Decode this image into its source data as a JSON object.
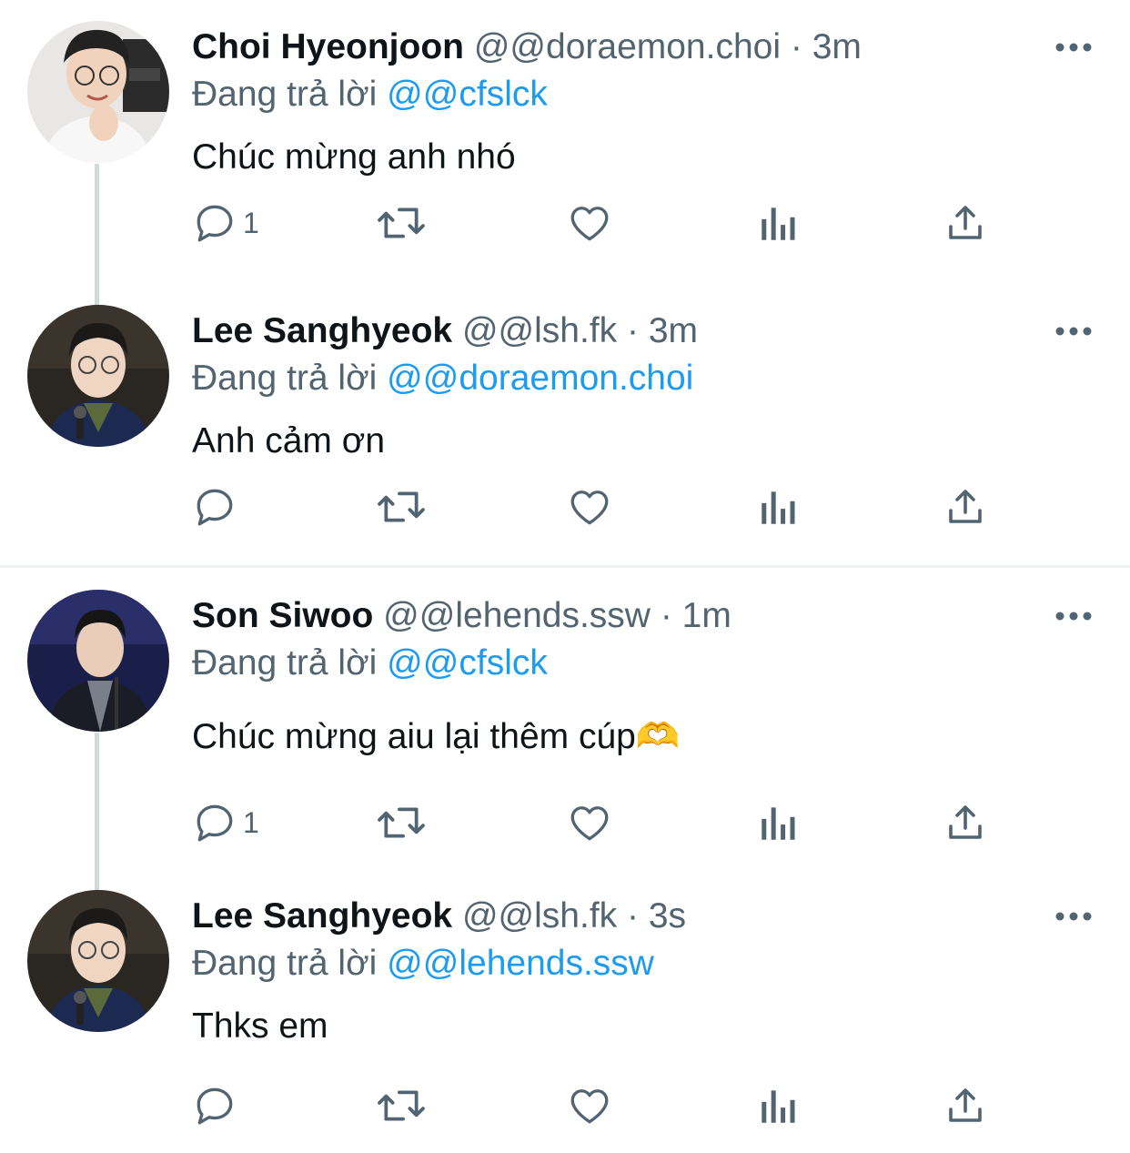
{
  "reply_prefix": "Đang trả lời",
  "colors": {
    "text": "#0f1419",
    "muted": "#536471",
    "link": "#1d9bf0",
    "thread_line": "#cfd9de",
    "divider": "#eff3f4"
  },
  "icons": [
    "reply-icon",
    "retweet-icon",
    "like-icon",
    "views-icon",
    "share-icon",
    "more-icon"
  ],
  "tweets": [
    {
      "name": "Choi Hyeonjoon",
      "handle": "@@doraemon.choi",
      "dot": "·",
      "time": "3m",
      "replying_to": "@@cfslck",
      "text": "Chúc mừng anh nhó",
      "reply_count": "1"
    },
    {
      "name": "Lee Sanghyeok",
      "handle": "@@lsh.fk",
      "dot": "·",
      "time": "3m",
      "replying_to": "@@doraemon.choi",
      "text": "Anh cảm ơn",
      "reply_count": ""
    },
    {
      "name": "Son Siwoo",
      "handle": "@@lehends.ssw",
      "dot": "·",
      "time": "1m",
      "replying_to": "@@cfslck",
      "text": "Chúc mừng aiu lại thêm cúp🫶",
      "reply_count": "1"
    },
    {
      "name": "Lee Sanghyeok",
      "handle": "@@lsh.fk",
      "dot": "·",
      "time": "3s",
      "replying_to": "@@lehends.ssw",
      "text": "Thks em",
      "reply_count": ""
    }
  ]
}
